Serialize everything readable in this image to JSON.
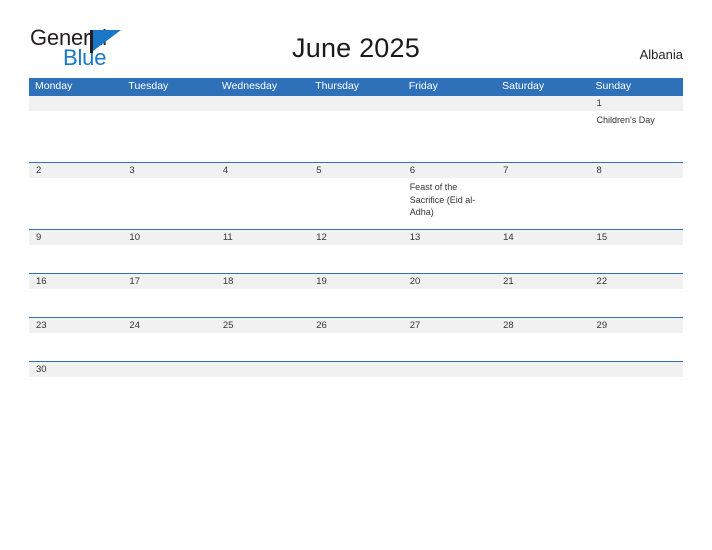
{
  "branding": {
    "logo_text_primary": "General",
    "logo_text_secondary": "Blue",
    "logo_flag_icon": "triangle-flag-icon",
    "accent_blue": "#2e71b8",
    "logo_blue": "#1878c6",
    "band_gray": "#f1f1f1"
  },
  "header": {
    "title": "June 2025",
    "region": "Albania"
  },
  "calendar": {
    "weekdays": [
      "Monday",
      "Tuesday",
      "Wednesday",
      "Thursday",
      "Friday",
      "Saturday",
      "Sunday"
    ],
    "weeks": [
      {
        "days": [
          {
            "num": "",
            "event": ""
          },
          {
            "num": "",
            "event": ""
          },
          {
            "num": "",
            "event": ""
          },
          {
            "num": "",
            "event": ""
          },
          {
            "num": "",
            "event": ""
          },
          {
            "num": "",
            "event": ""
          },
          {
            "num": "1",
            "event": "Children's Day"
          }
        ]
      },
      {
        "days": [
          {
            "num": "2",
            "event": ""
          },
          {
            "num": "3",
            "event": ""
          },
          {
            "num": "4",
            "event": ""
          },
          {
            "num": "5",
            "event": ""
          },
          {
            "num": "6",
            "event": "Feast of the Sacrifice (Eid al-Adha)"
          },
          {
            "num": "7",
            "event": ""
          },
          {
            "num": "8",
            "event": ""
          }
        ]
      },
      {
        "days": [
          {
            "num": "9",
            "event": ""
          },
          {
            "num": "10",
            "event": ""
          },
          {
            "num": "11",
            "event": ""
          },
          {
            "num": "12",
            "event": ""
          },
          {
            "num": "13",
            "event": ""
          },
          {
            "num": "14",
            "event": ""
          },
          {
            "num": "15",
            "event": ""
          }
        ]
      },
      {
        "days": [
          {
            "num": "16",
            "event": ""
          },
          {
            "num": "17",
            "event": ""
          },
          {
            "num": "18",
            "event": ""
          },
          {
            "num": "19",
            "event": ""
          },
          {
            "num": "20",
            "event": ""
          },
          {
            "num": "21",
            "event": ""
          },
          {
            "num": "22",
            "event": ""
          }
        ]
      },
      {
        "days": [
          {
            "num": "23",
            "event": ""
          },
          {
            "num": "24",
            "event": ""
          },
          {
            "num": "25",
            "event": ""
          },
          {
            "num": "26",
            "event": ""
          },
          {
            "num": "27",
            "event": ""
          },
          {
            "num": "28",
            "event": ""
          },
          {
            "num": "29",
            "event": ""
          }
        ]
      },
      {
        "days": [
          {
            "num": "30",
            "event": ""
          },
          {
            "num": "",
            "event": ""
          },
          {
            "num": "",
            "event": ""
          },
          {
            "num": "",
            "event": ""
          },
          {
            "num": "",
            "event": ""
          },
          {
            "num": "",
            "event": ""
          },
          {
            "num": "",
            "event": ""
          }
        ]
      }
    ]
  }
}
